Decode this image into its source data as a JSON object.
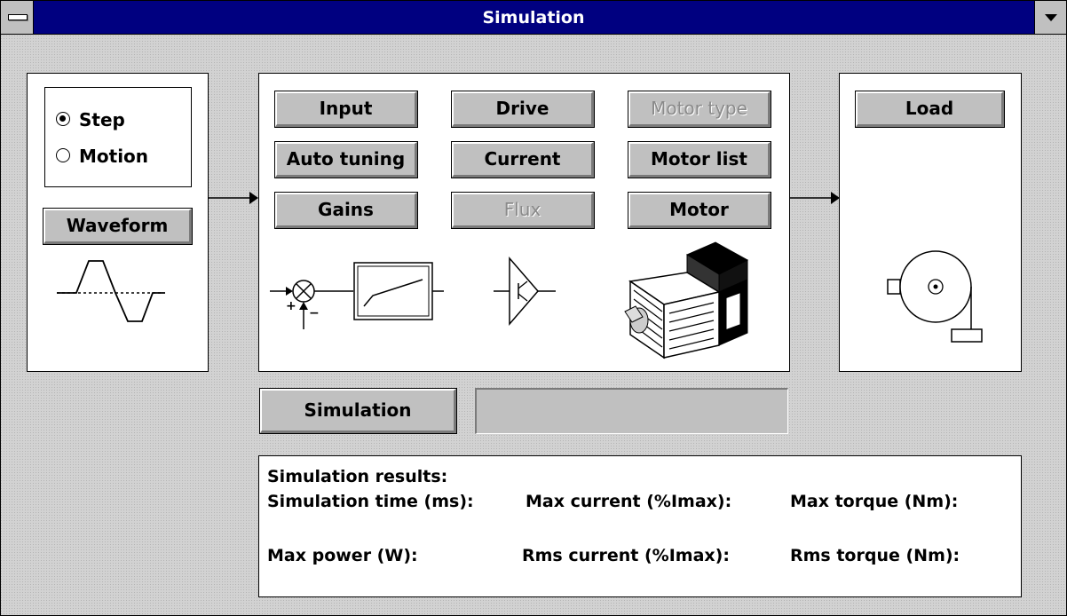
{
  "window": {
    "title": "Simulation"
  },
  "mode": {
    "options": [
      "Step",
      "Motion"
    ],
    "selected": "Step"
  },
  "buttons": {
    "waveform": "Waveform",
    "input": "Input",
    "drive": "Drive",
    "motor_type": "Motor type",
    "auto_tuning": "Auto tuning",
    "current": "Current",
    "motor_list": "Motor list",
    "gains": "Gains",
    "flux": "Flux",
    "motor": "Motor",
    "load": "Load",
    "simulation": "Simulation"
  },
  "disabled_buttons": [
    "Motor type",
    "Flux"
  ],
  "diagram": {
    "summing_plus": "+",
    "summing_minus": "−"
  },
  "results": {
    "heading": "Simulation results:",
    "simulation_time": "Simulation time (ms):",
    "max_current": "Max current (%Imax):",
    "max_torque": "Max torque (Nm):",
    "max_power": "Max power (W):",
    "rms_current": "Rms current (%Imax):",
    "rms_torque": "Rms torque (Nm):"
  },
  "progress": {
    "value": 0
  },
  "colors": {
    "titlebar": "#000080",
    "face": "#c0c0c0",
    "panel": "#ffffff"
  },
  "icons": [
    "system-menu-icon",
    "minimize-icon",
    "waveform-graph-icon",
    "arrow-right-icon",
    "summing-junction-icon",
    "filter-block-icon",
    "transistor-icon",
    "motor-icon",
    "load-pulley-icon"
  ]
}
